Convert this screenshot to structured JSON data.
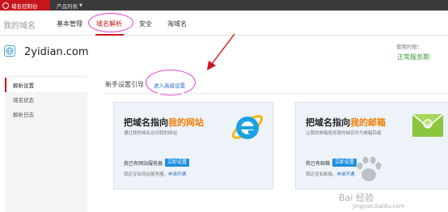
{
  "topbar": {
    "brand_label": "域名控制台",
    "products_label": "产品列表",
    "products_caret": "▼"
  },
  "header": {
    "my_domain": "我的域名",
    "tabs": [
      {
        "label": "基本管理",
        "active": false
      },
      {
        "label": "域名解析",
        "active": true
      },
      {
        "label": "安全",
        "active": false
      },
      {
        "label": "淘域名",
        "active": false
      }
    ]
  },
  "domain": {
    "name": "2yidian.com",
    "expiry_label": "使用时限：",
    "status": "正常服务期"
  },
  "sidebar": {
    "items": [
      {
        "label": "解析设置",
        "active": true
      },
      {
        "label": "域名状态",
        "active": false
      },
      {
        "label": "解析日志",
        "active": false
      }
    ]
  },
  "main": {
    "guide_title": "新手设置引导",
    "advanced_link": "进入高级设置",
    "website_card": {
      "title_prefix": "把域名指向",
      "title_highlight": "我的网站",
      "subtitle": "通过我的域名访问我的网站",
      "have_text": "我已有网站服务器",
      "setup_button": "立即设置",
      "no_prefix": "我还没有网站服务器，",
      "apply_link": "申请开通"
    },
    "email_card": {
      "title_prefix": "把域名指向",
      "title_highlight": "我的邮箱",
      "subtitle": "让我的邮箱使用我的域名作为邮箱后缀",
      "have_text": "我已有邮箱",
      "setup_button": "立即设置",
      "no_prefix": "我还没有邮箱，",
      "apply_link": "申请开通"
    }
  },
  "watermark": {
    "text": "Bai 经验",
    "url": "jingyan.baidu.com"
  },
  "colors": {
    "brand_red": "#c8161d",
    "annotation_magenta": "#e33dd8",
    "link_blue": "#2a6fc9",
    "button_blue": "#1f8ee0",
    "highlight_orange": "#f07c00",
    "status_green": "#3a9a3a"
  },
  "icons": {
    "domain": "globe-icon",
    "website": "internet-explorer-icon",
    "email": "mail-icon",
    "brand": "console-logo-icon"
  }
}
